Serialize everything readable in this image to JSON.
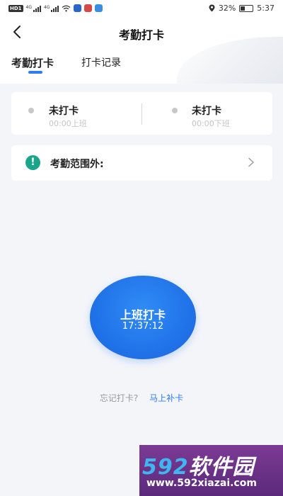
{
  "status_bar": {
    "left_badge": "HD",
    "left_badge_num": "1",
    "signal1_label": "4G",
    "signal2_label": "4G",
    "battery_percent": "32%",
    "time": "5:37"
  },
  "header": {
    "title": "考勤打卡"
  },
  "tabs": [
    {
      "label": "考勤打卡",
      "active": true
    },
    {
      "label": "打卡记录",
      "active": false
    }
  ],
  "status_card": {
    "clock_in": {
      "status": "未打卡",
      "detail": "00:00上班"
    },
    "clock_out": {
      "status": "未打卡",
      "detail": "00:00下班"
    }
  },
  "range": {
    "icon_text": "!",
    "label": "考勤范围外:"
  },
  "clock_button": {
    "label": "上班打卡",
    "time": "17:37:12"
  },
  "forget": {
    "question": "忘记打卡?",
    "link": "马上补卡"
  },
  "watermark": {
    "digits": "592",
    "text": "软件园",
    "url": "www.592xiazai.com"
  },
  "colors": {
    "accent": "#2f7bf6",
    "warning_icon": "#1aa58a",
    "background": "#f3f5f9"
  },
  "icons": {
    "back": "chevron-left-icon",
    "range_arrow": "chevron-right-icon",
    "warning": "exclamation-icon",
    "location": "location-icon",
    "wifi": "wifi-icon",
    "battery": "battery-icon"
  }
}
